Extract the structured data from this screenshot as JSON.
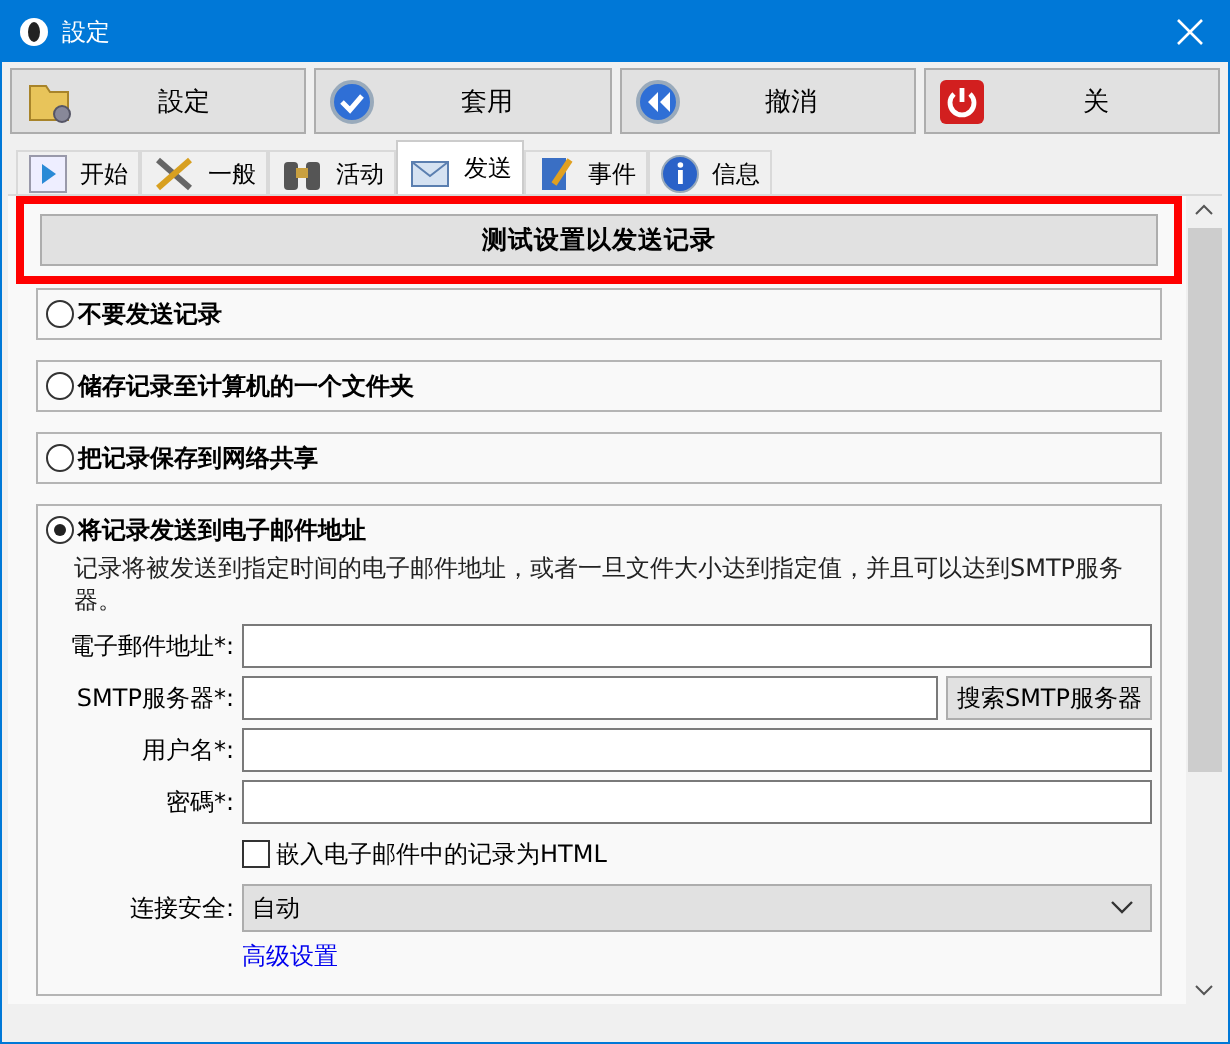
{
  "window": {
    "title": "設定"
  },
  "toolbar": [
    {
      "label": "設定"
    },
    {
      "label": "套用"
    },
    {
      "label": "撤消"
    },
    {
      "label": "关"
    }
  ],
  "tabs": [
    {
      "label": "开始",
      "selected": false
    },
    {
      "label": "一般",
      "selected": false
    },
    {
      "label": "活动",
      "selected": false
    },
    {
      "label": "发送",
      "selected": true
    },
    {
      "label": "事件",
      "selected": false
    },
    {
      "label": "信息",
      "selected": false
    }
  ],
  "test_button": {
    "label": "测试设置以发送记录",
    "highlighted": true
  },
  "options": [
    {
      "label": "不要发送记录",
      "selected": false
    },
    {
      "label": "储存记录至计算机的一个文件夹",
      "selected": false
    },
    {
      "label": "把记录保存到网络共享",
      "selected": false
    },
    {
      "label": "将记录发送到电子邮件地址",
      "selected": true
    }
  ],
  "email": {
    "description": "记录将被发送到指定时间的电子邮件地址，或者一旦文件大小达到指定值，并且可以达到SMTP服务器。",
    "fields": [
      {
        "label": "電子郵件地址*:"
      },
      {
        "label": "SMTP服务器*:",
        "button": "搜索SMTP服务器"
      },
      {
        "label": "用户名*:"
      },
      {
        "label": "密碼*:"
      }
    ],
    "embed_html": {
      "label": "嵌入电子邮件中的记录为HTML",
      "checked": false
    },
    "security": {
      "label": "连接安全:",
      "value": "自动"
    },
    "advanced_link": "高级设置"
  }
}
